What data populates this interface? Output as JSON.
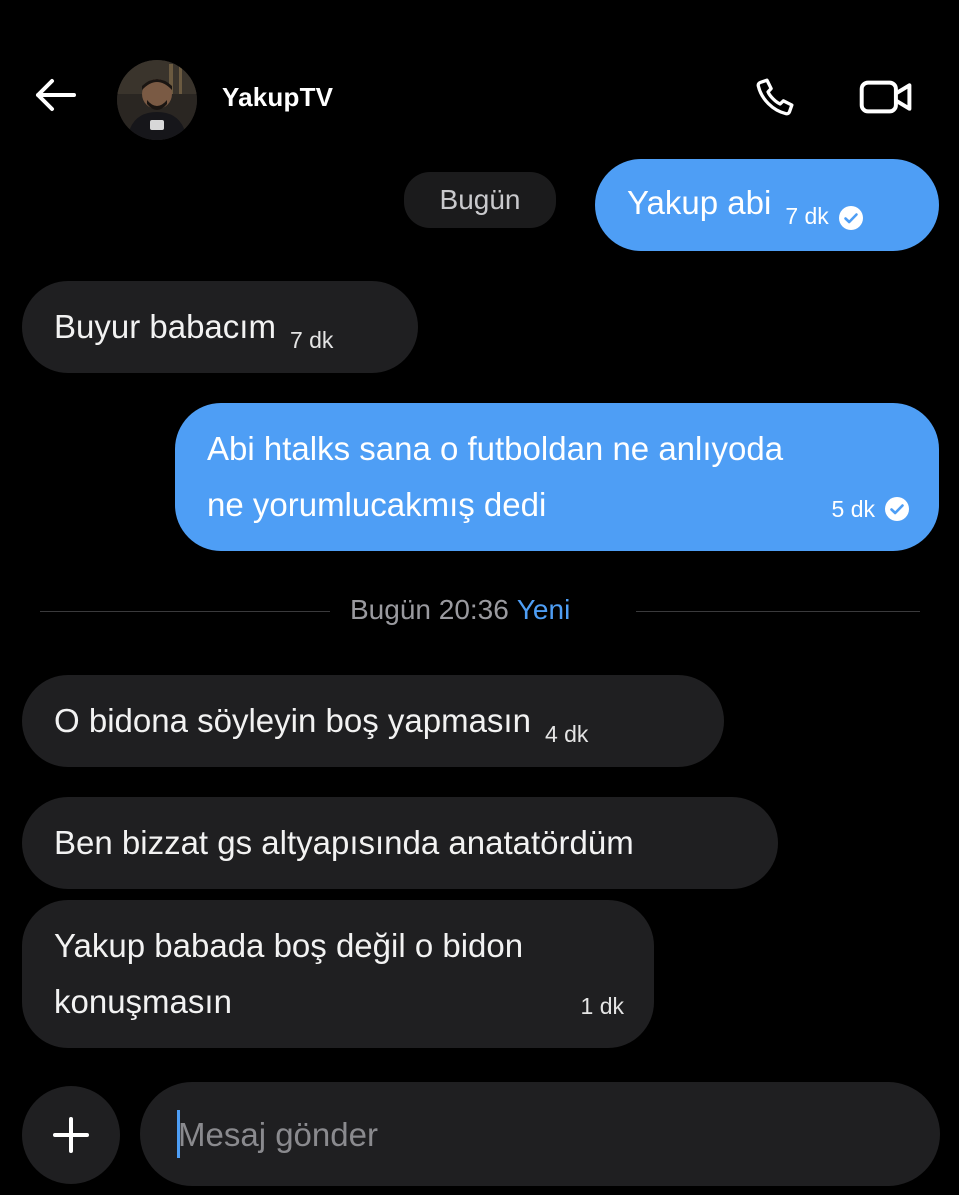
{
  "header": {
    "contact_name": "YakupTV",
    "back_icon": "arrow-left-icon",
    "call_icon": "phone-icon",
    "video_icon": "video-camera-icon"
  },
  "day_pill": "Bugün",
  "messages": [
    {
      "direction": "outgoing",
      "text": "Yakup abi",
      "time": "7 dk",
      "status_icon": "check-circle-icon"
    },
    {
      "direction": "incoming",
      "text": "Buyur babacım",
      "time": "7 dk"
    },
    {
      "direction": "outgoing",
      "lines": [
        "Abi htalks sana o futboldan ne anlıyoda",
        "ne yorumlucakmış dedi"
      ],
      "time": "5 dk",
      "status_icon": "check-circle-icon"
    },
    {
      "direction": "incoming",
      "text": "O bidona söyleyin boş yapmasın",
      "time": "4 dk"
    },
    {
      "direction": "incoming",
      "text": "Ben bizzat gs altyapısında anatatördüm"
    },
    {
      "direction": "incoming",
      "lines": [
        "Yakup babada boş değil o bidon",
        "konuşmasın"
      ],
      "time": "1 dk"
    }
  ],
  "divider": {
    "label": "Bugün 20:36",
    "new_label": "Yeni"
  },
  "composer": {
    "add_icon": "plus-icon",
    "placeholder": "Mesaj gönder",
    "value": ""
  },
  "colors": {
    "background": "#000000",
    "incoming_bubble": "#1f1f21",
    "outgoing_bubble": "#4e9ef5",
    "accent": "#4e9ef5"
  }
}
